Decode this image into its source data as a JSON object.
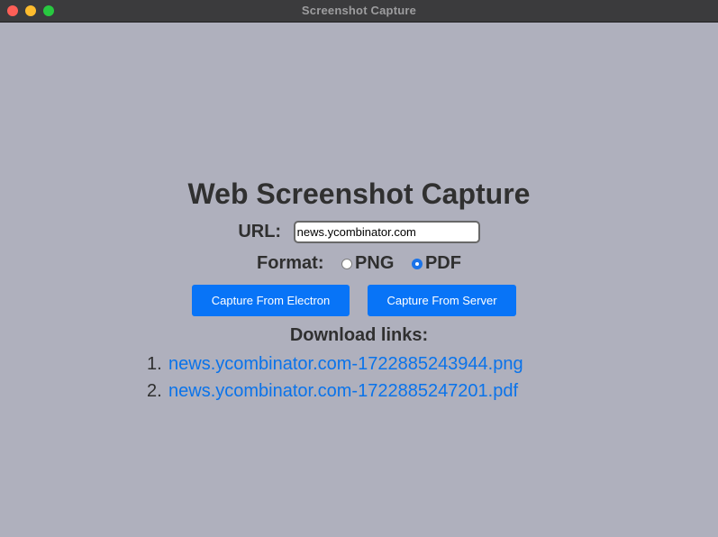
{
  "window": {
    "title": "Screenshot Capture"
  },
  "page": {
    "heading": "Web Screenshot Capture",
    "url_label": "URL:",
    "url_value": "news.ycombinator.com",
    "format_label": "Format:",
    "format_options": [
      {
        "label": "PNG",
        "selected": false
      },
      {
        "label": "PDF",
        "selected": true
      }
    ],
    "buttons": {
      "electron": "Capture From Electron",
      "server": "Capture From Server"
    },
    "download_heading": "Download links:",
    "download_links": [
      {
        "num": "1.",
        "text": "news.ycombinator.com-1722885243944.png"
      },
      {
        "num": "2.",
        "text": "news.ycombinator.com-1722885247201.pdf"
      }
    ]
  },
  "colors": {
    "background": "#afb0bd",
    "accent": "#0874f7",
    "link": "#0a73ea"
  }
}
